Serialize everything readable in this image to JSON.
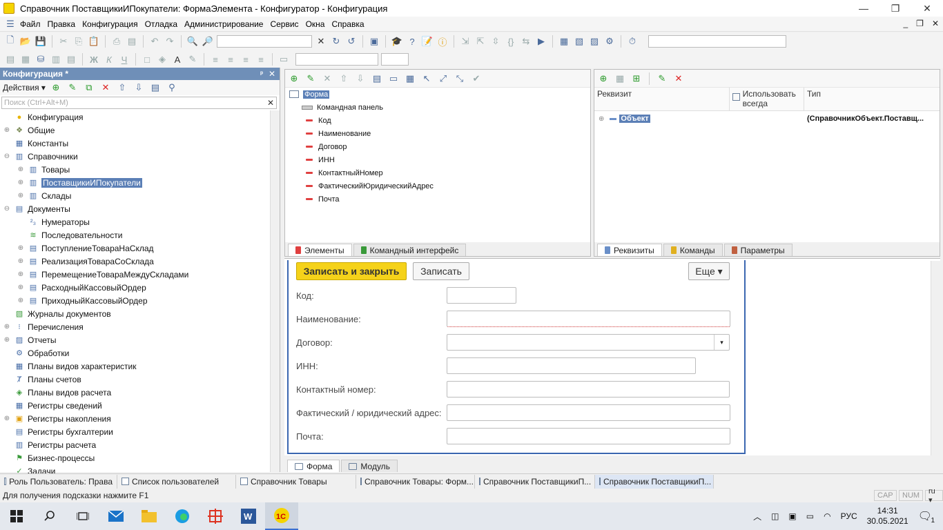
{
  "window": {
    "title": "Справочник ПоставщикиИПокупатели: ФормаЭлемента - Конфигуратор - Конфигурация",
    "minimize": "—",
    "restore": "❐",
    "close": "✕"
  },
  "menu": {
    "items": [
      "Файл",
      "Правка",
      "Конфигурация",
      "Отладка",
      "Администрирование",
      "Сервис",
      "Окна",
      "Справка"
    ],
    "mdi_min": "_",
    "mdi_restore": "❐",
    "mdi_close": "✕"
  },
  "config_panel": {
    "title": "Конфигурация *",
    "pin": "ᵖ",
    "close": "✕",
    "actions_label": "Действия ▾",
    "search_placeholder": "Поиск (Ctrl+Alt+M)",
    "search_clear": "✕",
    "tree": [
      {
        "label": "Конфигурация",
        "level": 0,
        "expander": "",
        "icon": "config-icon"
      },
      {
        "label": "Общие",
        "level": 0,
        "expander": "⊕",
        "icon": "common-icon"
      },
      {
        "label": "Константы",
        "level": 0,
        "expander": "",
        "icon": "constants-icon"
      },
      {
        "label": "Справочники",
        "level": 0,
        "expander": "⊖",
        "icon": "catalog-icon"
      },
      {
        "label": "Товары",
        "level": 1,
        "expander": "⊕",
        "icon": "catalog-icon"
      },
      {
        "label": "ПоставщикиИПокупатели",
        "level": 1,
        "expander": "⊕",
        "icon": "catalog-icon",
        "selected": true
      },
      {
        "label": "Склады",
        "level": 1,
        "expander": "⊕",
        "icon": "catalog-icon"
      },
      {
        "label": "Документы",
        "level": 0,
        "expander": "⊖",
        "icon": "document-icon"
      },
      {
        "label": "Нумераторы",
        "level": 1,
        "expander": "",
        "icon": "numerator-icon"
      },
      {
        "label": "Последовательности",
        "level": 1,
        "expander": "",
        "icon": "sequence-icon"
      },
      {
        "label": "ПоступлениеТовараНаСклад",
        "level": 1,
        "expander": "⊕",
        "icon": "document-icon"
      },
      {
        "label": "РеализацияТовараСоСклада",
        "level": 1,
        "expander": "⊕",
        "icon": "document-icon"
      },
      {
        "label": "ПеремещениеТовараМеждуСкладами",
        "level": 1,
        "expander": "⊕",
        "icon": "document-icon"
      },
      {
        "label": "РасходныйКассовыйОрдер",
        "level": 1,
        "expander": "⊕",
        "icon": "document-icon"
      },
      {
        "label": "ПриходныйКассовыйОрдер",
        "level": 1,
        "expander": "⊕",
        "icon": "document-icon"
      },
      {
        "label": "Журналы документов",
        "level": 0,
        "expander": "",
        "icon": "journal-icon"
      },
      {
        "label": "Перечисления",
        "level": 0,
        "expander": "⊕",
        "icon": "enum-icon"
      },
      {
        "label": "Отчеты",
        "level": 0,
        "expander": "⊕",
        "icon": "report-icon"
      },
      {
        "label": "Обработки",
        "level": 0,
        "expander": "",
        "icon": "dataprocessor-icon"
      },
      {
        "label": "Планы видов характеристик",
        "level": 0,
        "expander": "",
        "icon": "chart-of-characteristics-icon"
      },
      {
        "label": "Планы счетов",
        "level": 0,
        "expander": "",
        "icon": "chart-of-accounts-icon"
      },
      {
        "label": "Планы видов расчета",
        "level": 0,
        "expander": "",
        "icon": "calculation-types-icon"
      },
      {
        "label": "Регистры сведений",
        "level": 0,
        "expander": "",
        "icon": "information-register-icon"
      },
      {
        "label": "Регистры накопления",
        "level": 0,
        "expander": "⊕",
        "icon": "accumulation-register-icon"
      },
      {
        "label": "Регистры бухгалтерии",
        "level": 0,
        "expander": "",
        "icon": "accounting-register-icon"
      },
      {
        "label": "Регистры расчета",
        "level": 0,
        "expander": "",
        "icon": "calculation-register-icon"
      },
      {
        "label": "Бизнес-процессы",
        "level": 0,
        "expander": "",
        "icon": "business-process-icon"
      },
      {
        "label": "Задачи",
        "level": 0,
        "expander": "",
        "icon": "task-icon"
      }
    ]
  },
  "elements_panel": {
    "root": "Форма",
    "command_bar": "Командная панель",
    "items": [
      "Код",
      "Наименование",
      "Договор",
      "ИНН",
      "КонтактныйНомер",
      "ФактическийЮридическийАдрес",
      "Почта"
    ],
    "tabs": [
      "Элементы",
      "Командный интерфейс"
    ]
  },
  "attributes_panel": {
    "col_attribute": "Реквизит",
    "col_always": "Использовать всегда",
    "col_type": "Тип",
    "row_name": "Объект",
    "row_type": "(СправочникОбъект.Поставщ...",
    "tabs": [
      "Реквизиты",
      "Команды",
      "Параметры"
    ]
  },
  "preview_form": {
    "save_close": "Записать и закрыть",
    "save": "Записать",
    "more": "Еще ▾",
    "fields": [
      {
        "label": "Код:"
      },
      {
        "label": "Наименование:"
      },
      {
        "label": "Договор:"
      },
      {
        "label": "ИНН:"
      },
      {
        "label": "Контактный номер:"
      },
      {
        "label": "Фактический / юридический адрес:"
      },
      {
        "label": "Почта:"
      }
    ],
    "tabs": [
      "Форма",
      "Модуль"
    ]
  },
  "window_tabs": [
    "Роль Пользователь: Права",
    "Список пользователей",
    "Справочник Товары",
    "Справочник Товары: Форм...",
    "Справочник ПоставщикиП...",
    "Справочник ПоставщикиП..."
  ],
  "status": {
    "hint": "Для получения подсказки нажмите F1",
    "cap": "CAP",
    "num": "NUM",
    "lang": "ru ▾"
  },
  "taskbar": {
    "lang": "РУС",
    "time": "14:31",
    "date": "30.05.2021",
    "notif": "1"
  },
  "colors": {
    "accent": "#5b7fb6",
    "primary_button": "#f5d21a",
    "panel_header": "#6f8fb8"
  }
}
